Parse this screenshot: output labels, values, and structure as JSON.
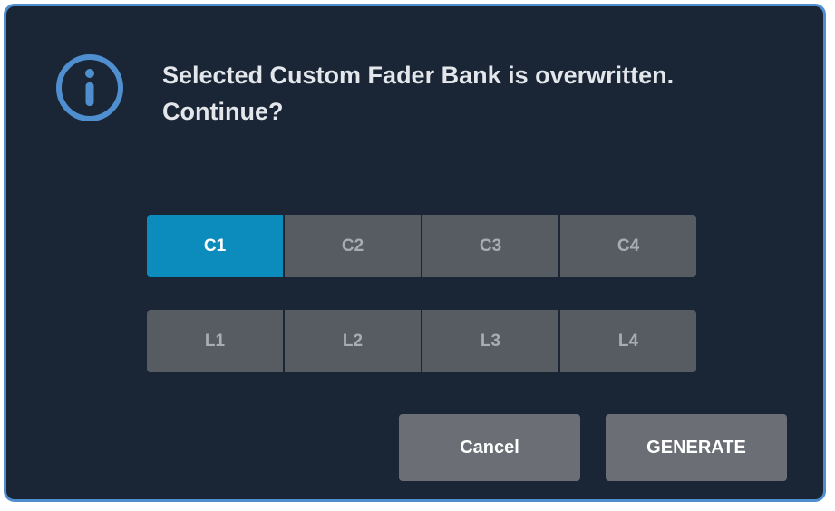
{
  "dialog": {
    "icon": "info-icon",
    "message_line1": "Selected Custom Fader Bank is overwritten.",
    "message_line2": "Continue?"
  },
  "custom_banks": [
    {
      "label": "C1",
      "selected": true
    },
    {
      "label": "C2",
      "selected": false
    },
    {
      "label": "C3",
      "selected": false
    },
    {
      "label": "C4",
      "selected": false
    }
  ],
  "layer_banks": [
    {
      "label": "L1",
      "selected": false
    },
    {
      "label": "L2",
      "selected": false
    },
    {
      "label": "L3",
      "selected": false
    },
    {
      "label": "L4",
      "selected": false
    }
  ],
  "buttons": {
    "cancel": "Cancel",
    "generate": "GENERATE"
  },
  "colors": {
    "background": "#1a2636",
    "border": "#4f8fcf",
    "selected": "#0b8cbd",
    "button": "#575b62",
    "action_button": "#6b6f75"
  }
}
